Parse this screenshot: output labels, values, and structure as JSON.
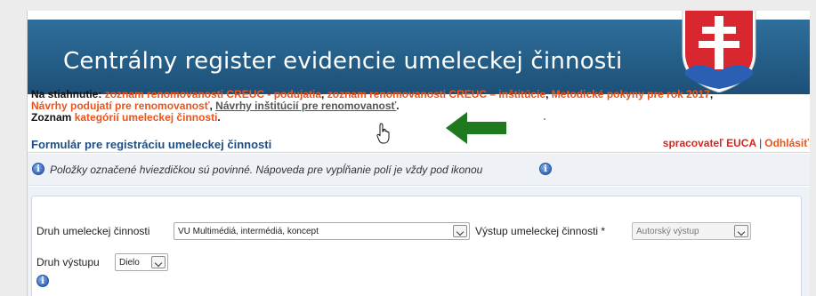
{
  "header": {
    "title": "Centrálny register evidencie umeleckej činnosti",
    "logo_icon": "slovak-coat-of-arms-icon"
  },
  "downloads": {
    "prefix": "Na stiahnutie:",
    "link1": "zoznam renomovanosti CREUC - podujatia",
    "sep1": ",",
    "link2": "zoznam renomovanosti CREUC – inštitúcie",
    "sep2": ",",
    "link3": "Metodické pokyny pre rok 2017",
    "sep3": ",",
    "link4": "Návrhy podujatí pre renomovanosť",
    "sep4": ",",
    "link5": "Návrhy inštitúcií pre renomovanosť",
    "sep5": ".",
    "list_prefix": "Zoznam",
    "list_link": "kategórií umeleckej činnosti",
    "list_end": "."
  },
  "form": {
    "title": "Formulár pre registráciu umeleckej činnosti",
    "user_label": "spracovateľ EUCA",
    "separator": "|",
    "logout": "Odhlásiť",
    "info_text": "Položky označené hviezdičkou sú povinné. Nápoveda pre vypĺňanie polí je vždy pod ikonou",
    "fields": {
      "druh_label": "Druh umeleckej činnosti",
      "druh_value": "VU Multimédiá, intermédiá, koncept",
      "vystup_label": "Výstup umeleckej činnosti *",
      "vystup_value": "Autorský výstup",
      "druh_vystupu_label": "Druh výstupu",
      "druh_vystupu_value": "Dielo"
    }
  },
  "colors": {
    "banner": "#245e87",
    "link_orange": "#e8541c",
    "title_blue": "#1f4f82",
    "user_red": "#d4261e",
    "arrow_green": "#1f7a1f"
  }
}
